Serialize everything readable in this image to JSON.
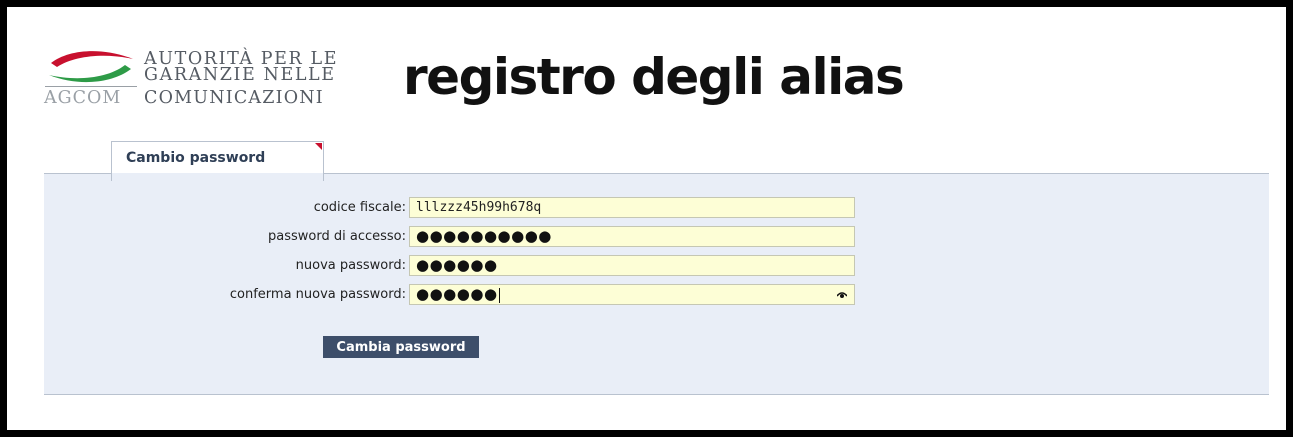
{
  "header": {
    "logo": {
      "line1": "AUTORITÀ PER LE",
      "line2": "GARANZIE NELLE",
      "abbr": "AGCOM",
      "line3": "COMUNICAZIONI",
      "colors": {
        "red": "#c8102e",
        "green": "#2e9b47",
        "gray": "#9aa0a6"
      }
    },
    "title": "registro degli alias"
  },
  "tab": {
    "label": "Cambio password",
    "corner_icon": "red-corner-triangle"
  },
  "form": {
    "fields": [
      {
        "label": "codice fiscale:",
        "value": "lllzzz45h99h678q",
        "type": "text"
      },
      {
        "label": "password di accesso:",
        "value": "●●●●●●●●●●",
        "type": "password"
      },
      {
        "label": "nuova password:",
        "value": "●●●●●●",
        "type": "password"
      },
      {
        "label": "conferma nuova password:",
        "value": "●●●●●●",
        "type": "password",
        "focused": true,
        "icon": "reveal-password-icon"
      }
    ],
    "submit_label": "Cambia password"
  },
  "colors": {
    "panel_bg": "#e9eef7",
    "input_bg": "#fdfed6",
    "button_bg": "#3d4e6a",
    "tab_text": "#2f3f56"
  }
}
